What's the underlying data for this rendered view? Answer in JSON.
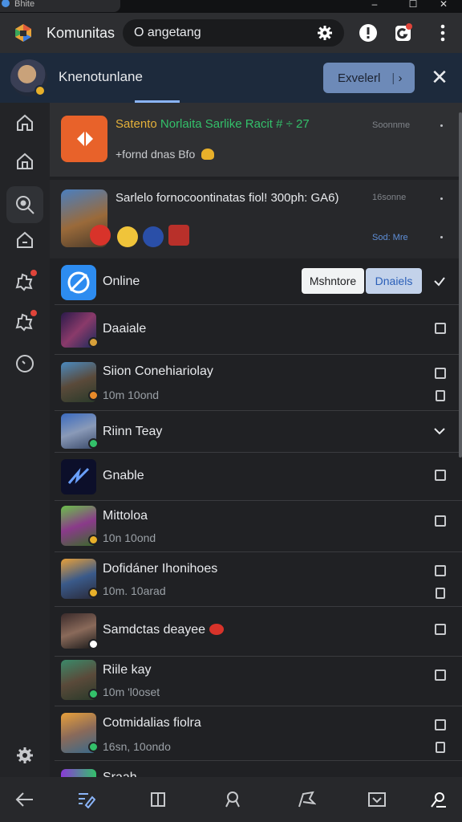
{
  "window": {
    "title": "Bhite",
    "controls": [
      "–",
      "☐",
      "✕"
    ]
  },
  "toolbar": {
    "brand": "Komunitas",
    "search_value": "O angetang"
  },
  "header": {
    "title": "Knenotunlane",
    "expand_label": "Exvelerl",
    "expand_arrow": "›",
    "close": "✕"
  },
  "notifications": [
    {
      "title_a": "Satento",
      "title_b": "Norlaita",
      "title_c": "Sarlike Racit",
      "title_d": "# ÷ 27",
      "subtitle": "+fornd dnas Bfo",
      "meta": "Soonnme"
    },
    {
      "title": "Sarlelo fornocoontinatas fiol! 300ph: GA6)",
      "meta_top": "16sonne",
      "meta_bottom": "Sod: Mre"
    }
  ],
  "online": {
    "label": "Online",
    "seg_left": "Mshntore",
    "seg_right": "Dnaiels"
  },
  "list": [
    {
      "name": "Daaiale",
      "time": ""
    },
    {
      "name": "Siion Conehiariolay",
      "time": "10m 10ond"
    },
    {
      "name": "Riinn Teay",
      "time": ""
    },
    {
      "name": "Gnable",
      "time": ""
    },
    {
      "name": "Mittoloa",
      "time": "10n 10ond"
    },
    {
      "name": "Dofidáner Ihonihoes",
      "time": "10m. 10arad"
    },
    {
      "name": "Samdctas deayee",
      "time": ""
    },
    {
      "name": "Riile kay",
      "time": "10m 'l0oset"
    },
    {
      "name": "Cotmidalias fiolra",
      "time": "16sn, 10ondo"
    },
    {
      "name": "Sraah",
      "time": ""
    }
  ],
  "colors": {
    "accent": "#8ab4f8",
    "header_bg": "#1d2a3c",
    "green": "#33c06a",
    "orange": "#e8622a"
  }
}
